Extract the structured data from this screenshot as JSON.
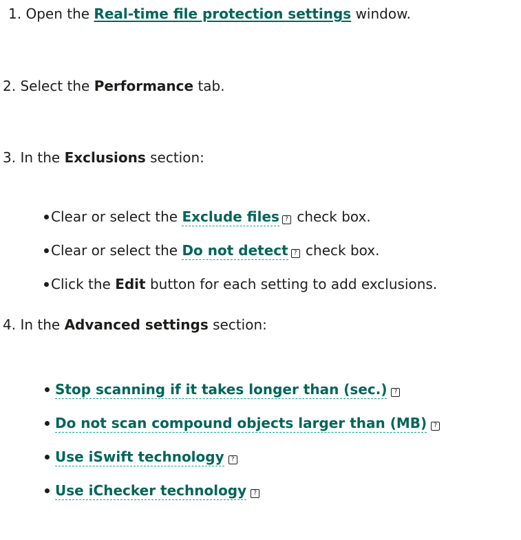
{
  "steps": {
    "s1": {
      "num": "1.",
      "pre": "Open the",
      "link": "Real-time file protection settings",
      "post": "window."
    },
    "s2": {
      "num": "2.",
      "pre": "Select the",
      "term": "Performance",
      "post": "tab."
    },
    "s3": {
      "num": "3.",
      "pre": "In the",
      "term": "Exclusions",
      "post": "section:"
    },
    "s4": {
      "num": "4.",
      "pre": "In the",
      "term": "Advanced settings",
      "post": "section:"
    }
  },
  "exclusions": [
    {
      "pre": "Clear or select the",
      "term": "Exclude files",
      "post": "check box."
    },
    {
      "pre": "Clear or select the",
      "term": "Do not detect",
      "post": "check box."
    },
    {
      "pre": "Click the",
      "term": "Edit",
      "post": "button for each setting to add exclusions."
    }
  ],
  "advanced": [
    {
      "term": "Stop scanning if it takes longer than (sec.)"
    },
    {
      "term": "Do not scan compound objects larger than (MB)"
    },
    {
      "term": "Use iSwift technology"
    },
    {
      "term": "Use iChecker technology"
    }
  ],
  "icons": {
    "help": "help-icon",
    "help_glyph": "?"
  },
  "colors": {
    "link": "#00655a",
    "text": "#1d1d1b",
    "dotted_underline": "#00a88e"
  }
}
